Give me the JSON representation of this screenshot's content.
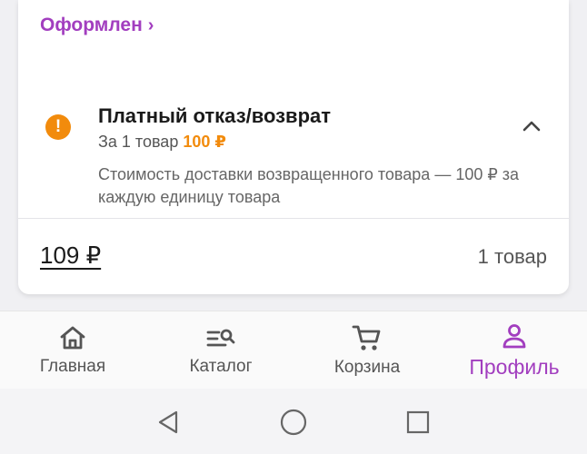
{
  "order": {
    "status_label": "Оформлен",
    "status_chevron": "›"
  },
  "refund": {
    "icon": "!",
    "title": "Платный отказ/возврат",
    "sub_prefix": "За 1 товар",
    "sub_price": "100 ₽",
    "description": "Стоимость доставки возвращенного товара — 100 ₽ за каждую единицу товара"
  },
  "summary": {
    "total": "109 ₽",
    "count": "1 товар"
  },
  "nav": {
    "home": "Главная",
    "catalog": "Каталог",
    "cart": "Корзина",
    "profile": "Профиль"
  },
  "colors": {
    "accent": "#a23ebf",
    "warning": "#f28b0c"
  }
}
